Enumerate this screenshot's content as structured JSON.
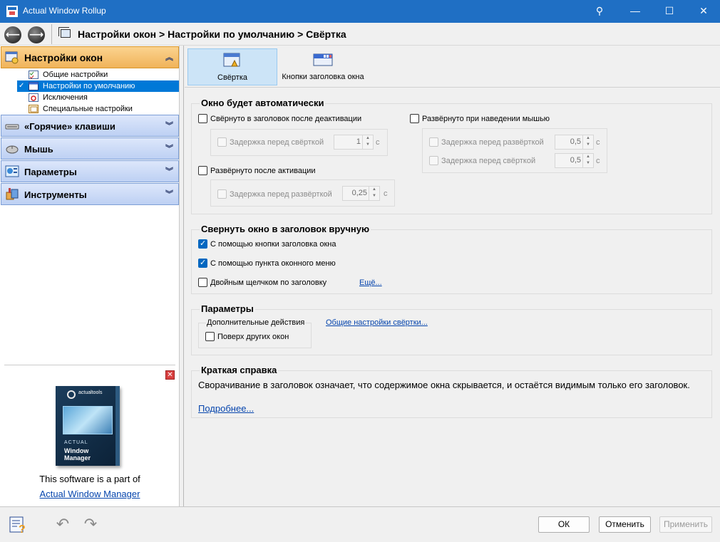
{
  "window": {
    "title": "Actual Window Rollup",
    "pin": "⚲",
    "minimize": "—",
    "maximize": "☐",
    "close": "✕"
  },
  "nav": {
    "breadcrumb": "Настройки окон > Настройки по умолчанию > Свёртка",
    "back": "⟵",
    "forward": "⟶"
  },
  "sidebar": {
    "categories": [
      {
        "label": "Настройки окон",
        "icon": "window-settings-icon",
        "expanded": true
      },
      {
        "label": "«Горячие» клавиши",
        "icon": "keyboard-icon",
        "expanded": false
      },
      {
        "label": "Мышь",
        "icon": "mouse-icon",
        "expanded": false
      },
      {
        "label": "Параметры",
        "icon": "parameters-icon",
        "expanded": false
      },
      {
        "label": "Инструменты",
        "icon": "tools-icon",
        "expanded": false
      }
    ],
    "chevron_up": "︽",
    "chevron_down": "︾",
    "items": [
      {
        "label": "Общие настройки",
        "selected": false
      },
      {
        "label": "Настройки по умолчанию",
        "selected": true
      },
      {
        "label": "Исключения",
        "selected": false
      },
      {
        "label": "Специальные настройки",
        "selected": false
      }
    ],
    "check_mark": "✓",
    "promo": {
      "close": "✕",
      "box_brand": "actualtools",
      "box_title_small": "ACTUAL",
      "box_title": "Window Manager",
      "text": "This software is a part of",
      "link": "Actual Window Manager"
    }
  },
  "toolbar": {
    "tools": [
      {
        "label": "Свёртка",
        "icon": "rollup-icon",
        "active": true
      },
      {
        "label": "Кнопки заголовка окна",
        "icon": "title-buttons-icon",
        "active": false
      }
    ]
  },
  "auto_group": {
    "title": "Окно будет автоматически",
    "rollup_on_deactivate": {
      "label": "Свёрнуто в заголовок после деактивации",
      "checked": false
    },
    "rollup_delay": {
      "label": "Задержка перед свёрткой",
      "value": "1",
      "unit": "с",
      "enabled": false
    },
    "unroll_on_activate": {
      "label": "Развёрнуто после активации",
      "checked": false
    },
    "unroll_after_delay": {
      "label": "Задержка перед развёрткой",
      "value": "0,25",
      "unit": "с",
      "enabled": false
    },
    "unroll_on_hover": {
      "label": "Развёрнуто при наведении мышью",
      "checked": false
    },
    "hover_unroll_delay": {
      "label": "Задержка перед развёрткой",
      "value": "0,5",
      "unit": "с",
      "enabled": false
    },
    "hover_rollup_delay": {
      "label": "Задержка перед свёрткой",
      "value": "0,5",
      "unit": "с",
      "enabled": false
    }
  },
  "manual_group": {
    "title": "Свернуть окно в заголовок вручную",
    "by_title_button": {
      "label": "С помощью кнопки заголовка окна",
      "checked": true
    },
    "by_menu_item": {
      "label": "С помощью пункта оконного меню",
      "checked": true
    },
    "by_double_click": {
      "label": "Двойным щелчком по заголовку",
      "checked": false
    },
    "more_link": "Ещё..."
  },
  "params_group": {
    "title": "Параметры",
    "extra_actions_label": "Дополнительные действия",
    "on_top": {
      "label": "Поверх других окон",
      "checked": false
    },
    "general_rollup_link": "Общие настройки свёртки..."
  },
  "help_group": {
    "title": "Краткая справка",
    "text": "Сворачивание в заголовок означает, что содержимое окна скрывается, и остаётся видимым только его заголовок.",
    "more_link": "Подробнее..."
  },
  "bottom": {
    "undo": "↶",
    "redo": "↷",
    "ok": "ОК",
    "cancel": "Отменить",
    "apply": "Применить"
  },
  "colors": {
    "titlebar": "#1f6fc4",
    "active_category": "#f0b35a",
    "category": "#bdd0f3",
    "selection": "#0078d7",
    "link": "#0645ad",
    "checkbox_checked": "#0067c0"
  }
}
